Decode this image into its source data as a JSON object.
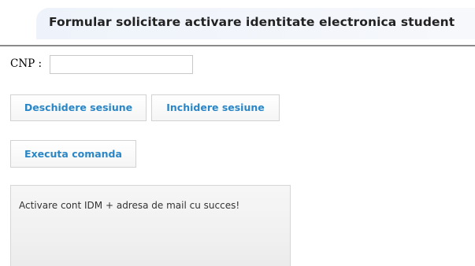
{
  "header": {
    "title": "Formular solicitare activare identitate electronica student"
  },
  "form": {
    "cnp_label": "CNP :",
    "cnp_value": "",
    "cnp_placeholder": ""
  },
  "buttons": {
    "open_session": "Deschidere sesiune",
    "close_session": "Inchidere sesiune",
    "execute": "Executa comanda"
  },
  "result": {
    "message": "Activare cont IDM + adresa de mail cu succes!"
  },
  "colors": {
    "button_text": "#2a86c6",
    "header_bg": "#eef3fb",
    "rule": "#8a8a8a"
  }
}
